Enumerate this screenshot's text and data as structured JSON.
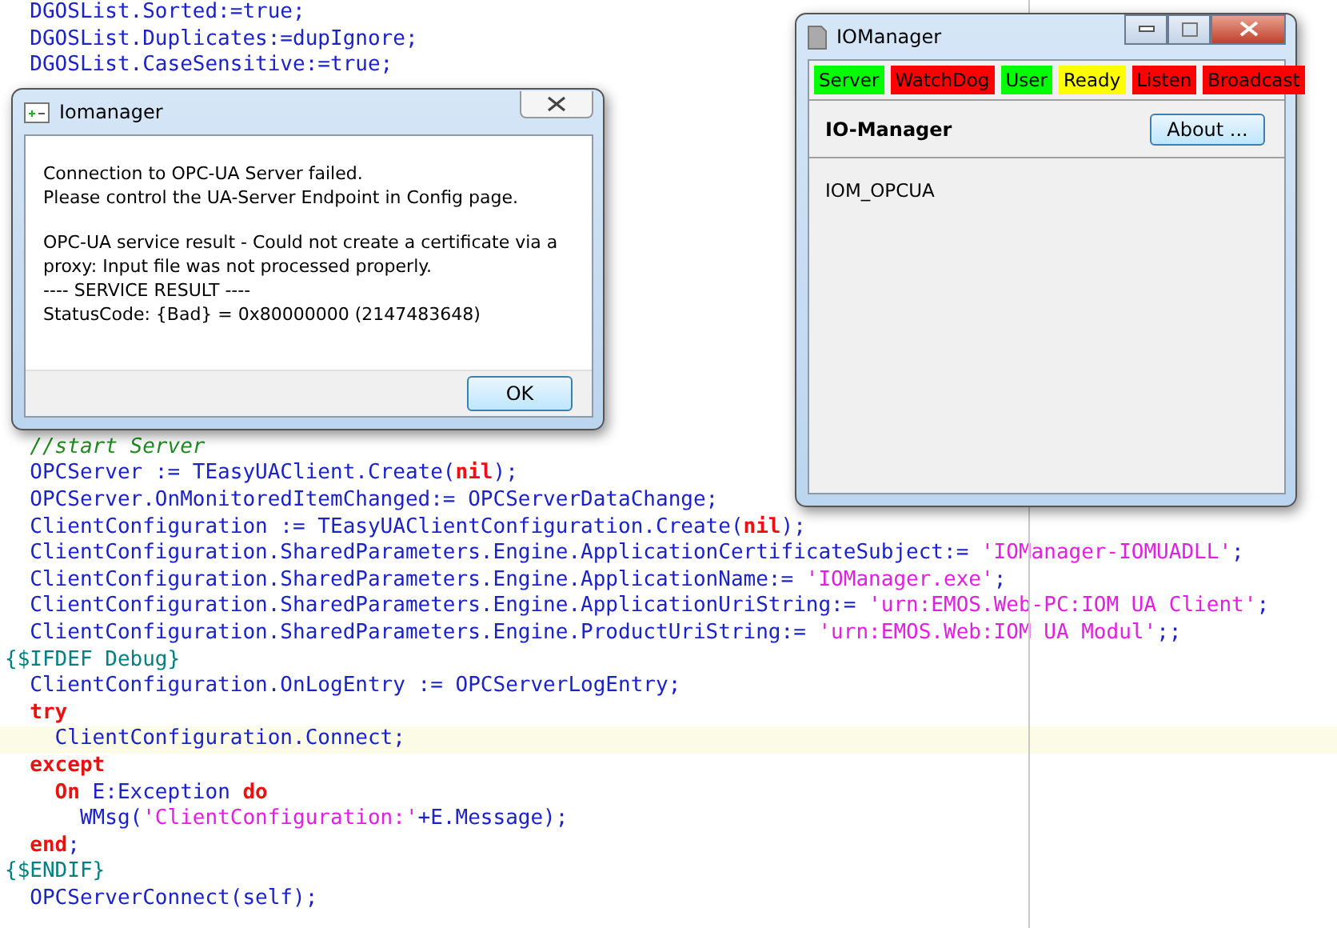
{
  "editor": {
    "top_lines": [
      {
        "current": false,
        "tokens": [
          {
            "kind": "ident",
            "text": "  DGOSList.Sorted:=true;"
          }
        ]
      },
      {
        "current": false,
        "tokens": [
          {
            "kind": "ident",
            "text": "  DGOSList.Duplicates:=dupIgnore;"
          }
        ]
      },
      {
        "current": false,
        "tokens": [
          {
            "kind": "ident",
            "text": "  DGOSList.CaseSensitive:=true;"
          }
        ]
      }
    ],
    "bottom_lines": [
      {
        "current": false,
        "tokens": [
          {
            "kind": "comment",
            "text": "  //start Server"
          }
        ]
      },
      {
        "current": false,
        "tokens": [
          {
            "kind": "ident",
            "text": "  OPCServer := TEasyUAClient.Create("
          },
          {
            "kind": "keyword",
            "text": "nil"
          },
          {
            "kind": "ident",
            "text": ");"
          }
        ]
      },
      {
        "current": false,
        "tokens": [
          {
            "kind": "ident",
            "text": "  OPCServer.OnMonitoredItemChanged:= OPCServerDataChange;"
          }
        ]
      },
      {
        "current": false,
        "tokens": [
          {
            "kind": "ident",
            "text": "  ClientConfiguration := TEasyUAClientConfiguration.Create("
          },
          {
            "kind": "keyword",
            "text": "nil"
          },
          {
            "kind": "ident",
            "text": ");"
          }
        ]
      },
      {
        "current": false,
        "tokens": [
          {
            "kind": "ident",
            "text": "  ClientConfiguration.SharedParameters.Engine.ApplicationCertificateSubject:= "
          },
          {
            "kind": "string",
            "text": "'IOManager-IOMUADLL'"
          },
          {
            "kind": "ident",
            "text": ";"
          }
        ]
      },
      {
        "current": false,
        "tokens": [
          {
            "kind": "ident",
            "text": "  ClientConfiguration.SharedParameters.Engine.ApplicationName:= "
          },
          {
            "kind": "string",
            "text": "'IOManager.exe'"
          },
          {
            "kind": "ident",
            "text": ";"
          }
        ]
      },
      {
        "current": false,
        "tokens": [
          {
            "kind": "ident",
            "text": "  ClientConfiguration.SharedParameters.Engine.ApplicationUriString:= "
          },
          {
            "kind": "string",
            "text": "'urn:EMOS.Web-PC:IOM UA Client'"
          },
          {
            "kind": "ident",
            "text": ";"
          }
        ]
      },
      {
        "current": false,
        "tokens": [
          {
            "kind": "ident",
            "text": "  ClientConfiguration.SharedParameters.Engine.ProductUriString:= "
          },
          {
            "kind": "string",
            "text": "'urn:EMOS.Web:IOM UA Modul'"
          },
          {
            "kind": "ident",
            "text": ";;"
          }
        ]
      },
      {
        "current": false,
        "tokens": [
          {
            "kind": "directive",
            "text": "{$IFDEF Debug}"
          }
        ]
      },
      {
        "current": false,
        "tokens": [
          {
            "kind": "ident",
            "text": "  ClientConfiguration.OnLogEntry := OPCServerLogEntry;"
          }
        ]
      },
      {
        "current": false,
        "tokens": [
          {
            "kind": "keyword",
            "text": "  try"
          }
        ]
      },
      {
        "current": true,
        "tokens": [
          {
            "kind": "ident",
            "text": "    ClientConfiguration.Connect;"
          }
        ]
      },
      {
        "current": false,
        "tokens": [
          {
            "kind": "keyword",
            "text": "  except"
          }
        ]
      },
      {
        "current": false,
        "tokens": [
          {
            "kind": "keyword",
            "text": "    On "
          },
          {
            "kind": "ident",
            "text": "E:Exception "
          },
          {
            "kind": "keyword",
            "text": "do"
          }
        ]
      },
      {
        "current": false,
        "tokens": [
          {
            "kind": "ident",
            "text": "      WMsg("
          },
          {
            "kind": "string",
            "text": "'ClientConfiguration:'"
          },
          {
            "kind": "ident",
            "text": "+E.Message);"
          }
        ]
      },
      {
        "current": false,
        "tokens": [
          {
            "kind": "keyword",
            "text": "  end"
          },
          {
            "kind": "ident",
            "text": ";"
          }
        ]
      },
      {
        "current": false,
        "tokens": [
          {
            "kind": "directive",
            "text": "{$ENDIF}"
          }
        ]
      },
      {
        "current": false,
        "tokens": [
          {
            "kind": "ident",
            "text": "  OPCServerConnect(self);"
          }
        ]
      }
    ]
  },
  "error_dialog": {
    "title": "Iomanager",
    "paragraphs": [
      "Connection to OPC-UA Server failed.\nPlease control the UA-Server Endpoint in Config page.",
      "OPC-UA service result - Could not create a certificate via a proxy: Input file was not processed properly.\n---- SERVICE RESULT ----\nStatusCode: {Bad} = 0x80000000 (2147483648)"
    ],
    "button": "OK"
  },
  "iomanager_window": {
    "title": "IOManager",
    "status_flags": [
      {
        "label": "Server",
        "color": "#00ff00"
      },
      {
        "label": "WatchDog",
        "color": "#ff0000"
      },
      {
        "label": "User",
        "color": "#00ff00"
      },
      {
        "label": "Ready",
        "color": "#ffff00"
      },
      {
        "label": "Listen",
        "color": "#ff0000"
      },
      {
        "label": "Broadcast",
        "color": "#ff0000"
      }
    ],
    "heading": "IO-Manager",
    "about_button": "About ...",
    "module": "IOM_OPCUA"
  }
}
